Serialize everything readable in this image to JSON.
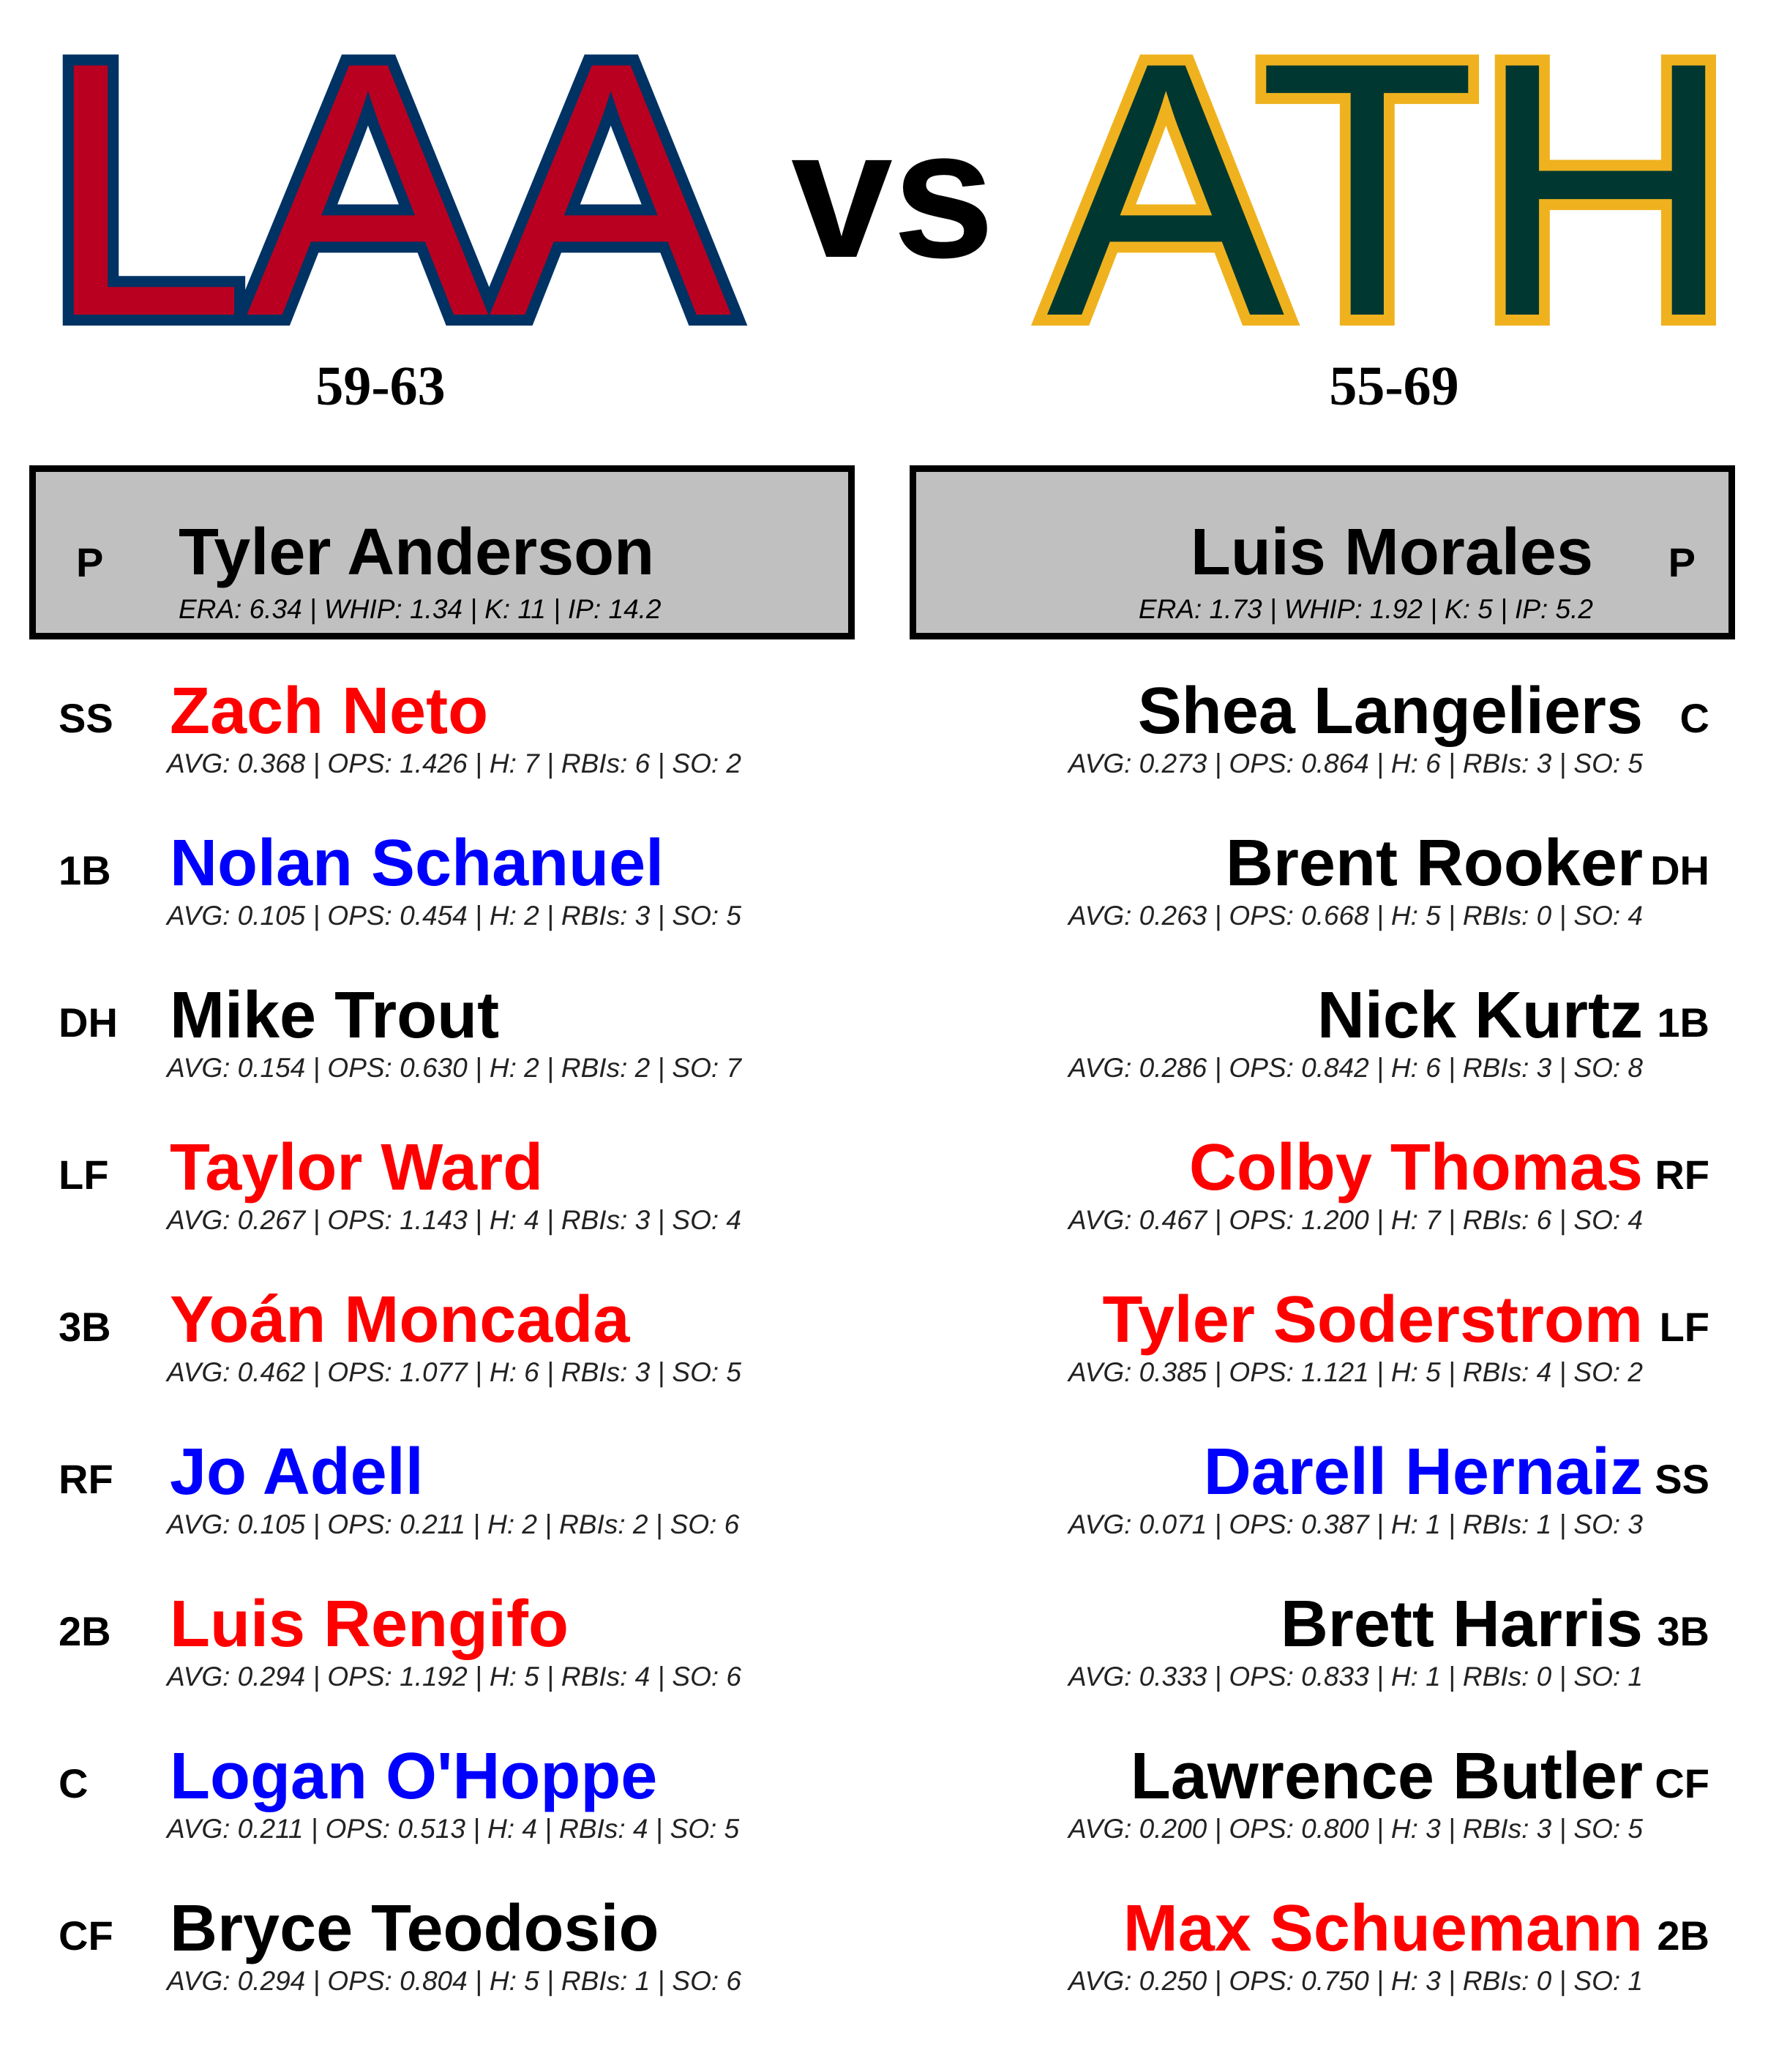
{
  "matchup": {
    "vs_label": "vs",
    "home": {
      "abbr": "LAA",
      "record": "59-63",
      "colors": {
        "fill": "#ba0021",
        "outline": "#003263"
      },
      "pitcher": {
        "pos": "P",
        "name": "Tyler Anderson",
        "stats": "ERA: 6.34 | WHIP: 1.34 | K: 11 | IP: 14.2"
      },
      "lineup": [
        {
          "pos": "SS",
          "name": "Zach Neto",
          "color": "#ff0000",
          "stats": "AVG: 0.368 | OPS: 1.426 | H: 7 | RBIs: 6 | SO: 2"
        },
        {
          "pos": "1B",
          "name": "Nolan Schanuel",
          "color": "#0000ff",
          "stats": "AVG: 0.105 | OPS: 0.454 | H: 2 | RBIs: 3 | SO: 5"
        },
        {
          "pos": "DH",
          "name": "Mike Trout",
          "color": "#000000",
          "stats": "AVG: 0.154 | OPS: 0.630 | H: 2 | RBIs: 2 | SO: 7"
        },
        {
          "pos": "LF",
          "name": "Taylor Ward",
          "color": "#ff0000",
          "stats": "AVG: 0.267 | OPS: 1.143 | H: 4 | RBIs: 3 | SO: 4"
        },
        {
          "pos": "3B",
          "name": "Yoán Moncada",
          "color": "#ff0000",
          "stats": "AVG: 0.462 | OPS: 1.077 | H: 6 | RBIs: 3 | SO: 5"
        },
        {
          "pos": "RF",
          "name": "Jo Adell",
          "color": "#0000ff",
          "stats": "AVG: 0.105 | OPS: 0.211 | H: 2 | RBIs: 2 | SO: 6"
        },
        {
          "pos": "2B",
          "name": "Luis Rengifo",
          "color": "#ff0000",
          "stats": "AVG: 0.294 | OPS: 1.192 | H: 5 | RBIs: 4 | SO: 6"
        },
        {
          "pos": "C",
          "name": "Logan O'Hoppe",
          "color": "#0000ff",
          "stats": "AVG: 0.211 | OPS: 0.513 | H: 4 | RBIs: 4 | SO: 5"
        },
        {
          "pos": "CF",
          "name": "Bryce Teodosio",
          "color": "#000000",
          "stats": "AVG: 0.294 | OPS: 0.804 | H: 5 | RBIs: 1 | SO: 6"
        }
      ]
    },
    "away": {
      "abbr": "ATH",
      "record": "55-69",
      "colors": {
        "fill": "#003831",
        "outline": "#efb21e"
      },
      "pitcher": {
        "pos": "P",
        "name": "Luis Morales",
        "stats": "ERA: 1.73 | WHIP: 1.92 | K: 5 | IP: 5.2"
      },
      "lineup": [
        {
          "pos": "C",
          "name": "Shea Langeliers",
          "color": "#000000",
          "stats": "AVG: 0.273 | OPS: 0.864 | H: 6 | RBIs: 3 | SO: 5"
        },
        {
          "pos": "DH",
          "name": "Brent Rooker",
          "color": "#000000",
          "stats": "AVG: 0.263 | OPS: 0.668 | H: 5 | RBIs: 0 | SO: 4"
        },
        {
          "pos": "1B",
          "name": "Nick Kurtz",
          "color": "#000000",
          "stats": "AVG: 0.286 | OPS: 0.842 | H: 6 | RBIs: 3 | SO: 8"
        },
        {
          "pos": "RF",
          "name": "Colby Thomas",
          "color": "#ff0000",
          "stats": "AVG: 0.467 | OPS: 1.200 | H: 7 | RBIs: 6 | SO: 4"
        },
        {
          "pos": "LF",
          "name": "Tyler Soderstrom",
          "color": "#ff0000",
          "stats": "AVG: 0.385 | OPS: 1.121 | H: 5 | RBIs: 4 | SO: 2"
        },
        {
          "pos": "SS",
          "name": "Darell Hernaiz",
          "color": "#0000ff",
          "stats": "AVG: 0.071 | OPS: 0.387 | H: 1 | RBIs: 1 | SO: 3"
        },
        {
          "pos": "3B",
          "name": "Brett Harris",
          "color": "#000000",
          "stats": "AVG: 0.333 | OPS: 0.833 | H: 1 | RBIs: 0 | SO: 1"
        },
        {
          "pos": "CF",
          "name": "Lawrence Butler",
          "color": "#000000",
          "stats": "AVG: 0.200 | OPS: 0.800 | H: 3 | RBIs: 3 | SO: 5"
        },
        {
          "pos": "2B",
          "name": "Max Schuemann",
          "color": "#ff0000",
          "stats": "AVG: 0.250 | OPS: 0.750 | H: 3 | RBIs: 0 | SO: 1"
        }
      ]
    }
  }
}
